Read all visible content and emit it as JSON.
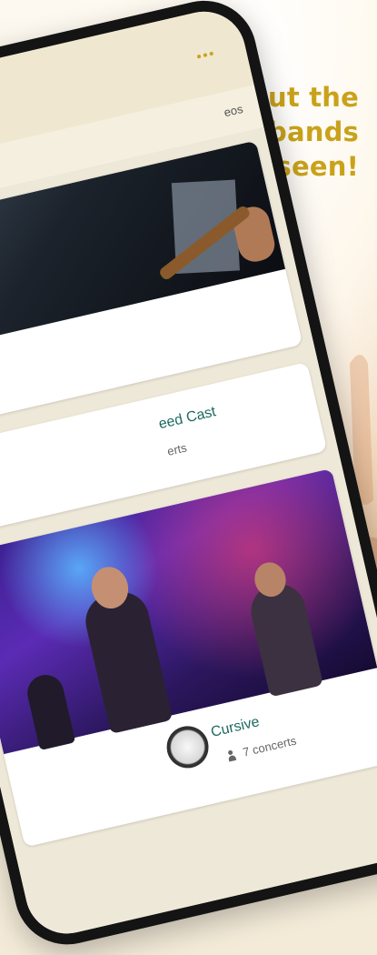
{
  "headline": {
    "line1": "Get stats about the",
    "line2": "concerts and bands",
    "line3": "you've seen!"
  },
  "app": {
    "overflow_icon": "more-dots-icon",
    "tab_visible_label": "eos"
  },
  "cards": [
    {
      "type": "photo",
      "image": "guitarist-photo"
    },
    {
      "name": "eed Cast",
      "count": "erts"
    },
    {
      "type": "photo-band",
      "image": "band-on-stage-photo",
      "name": "Cursive",
      "count": "7 concerts",
      "count_icon": "people-icon"
    }
  ],
  "colors": {
    "headline": "#c9a21a",
    "band_name": "#1d6a62",
    "phone_frame": "#141414"
  }
}
